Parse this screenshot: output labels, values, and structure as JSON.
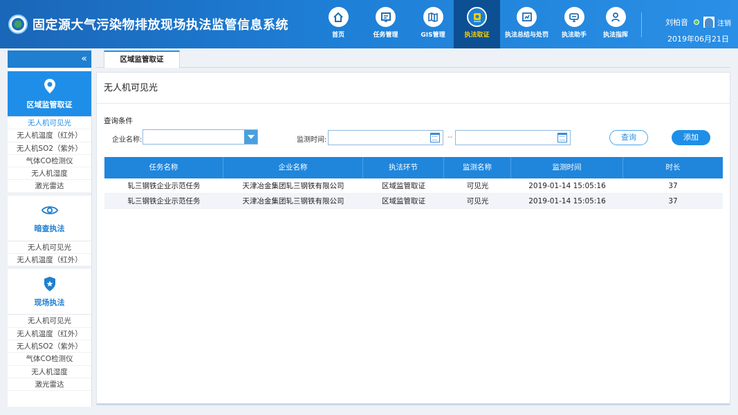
{
  "header": {
    "title": "固定源大气污染物排放现场执法监管信息系统",
    "nav": [
      {
        "label": "首页",
        "icon": "home-icon"
      },
      {
        "label": "任务管理",
        "icon": "task-icon"
      },
      {
        "label": "GIS管理",
        "icon": "map-icon"
      },
      {
        "label": "执法取证",
        "icon": "evidence-icon",
        "active": true
      },
      {
        "label": "执法总结与处罚",
        "icon": "summary-icon"
      },
      {
        "label": "执法助手",
        "icon": "assistant-icon"
      },
      {
        "label": "执法指挥",
        "icon": "command-icon"
      }
    ],
    "user_name": "刘柏音",
    "logout_label": "注销",
    "date": "2019年06月21日"
  },
  "sidebar": {
    "collapse_glyph": "«",
    "groups": [
      {
        "title": "区域监管取证",
        "icon": "location-pin-icon",
        "items": [
          "无人机可见光",
          "无人机温度（红外）",
          "无人机SO2（紫外）",
          "气体CO检测仪",
          "无人机湿度",
          "激光雷达"
        ]
      },
      {
        "title": "暗查执法",
        "icon": "eye-icon",
        "items": [
          "无人机可见光",
          "无人机温度（红外）"
        ]
      },
      {
        "title": "现场执法",
        "icon": "badge-icon",
        "items": [
          "无人机可见光",
          "无人机温度（红外）",
          "无人机SO2（紫外）",
          "气体CO检测仪",
          "无人机湿度",
          "激光雷达"
        ]
      }
    ]
  },
  "tabs": [
    {
      "label": "区域监管取证"
    }
  ],
  "main": {
    "title": "无人机可见光",
    "query_title": "查询条件",
    "company_label": "企业名称:",
    "company_value": "",
    "time_label": "监测时间:",
    "date_separator": "--",
    "query_button": "查询",
    "add_button": "添加"
  },
  "table": {
    "headers": [
      "任务名称",
      "企业名称",
      "执法环节",
      "监测名称",
      "监测时间",
      "时长"
    ],
    "rows": [
      [
        "轧三钢铁企业示范任务",
        "天津冶金集团轧三钢铁有限公司",
        "区域监管取证",
        "可见光",
        "2019-01-14 15:05:16",
        "37"
      ],
      [
        "轧三钢铁企业示范任务",
        "天津冶金集团轧三钢铁有限公司",
        "区域监管取证",
        "可见光",
        "2019-01-14 15:05:16",
        "37"
      ]
    ]
  },
  "colors": {
    "accent": "#1f8ee8",
    "header_bg": "#1e7fd6",
    "active_nav": "#0c4f93"
  }
}
